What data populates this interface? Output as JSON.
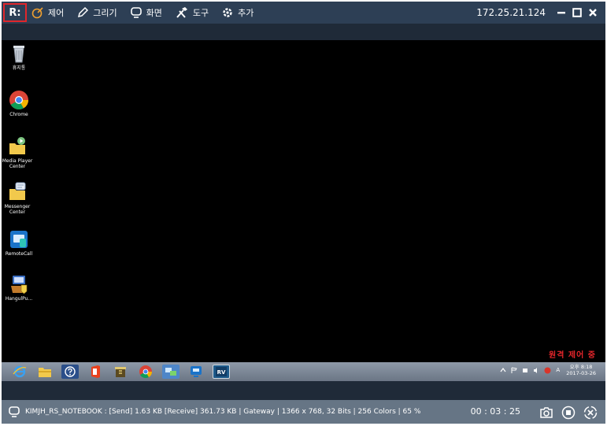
{
  "toolbar": {
    "logo": "R:",
    "menu": [
      {
        "label": "제어",
        "icon": "control-icon"
      },
      {
        "label": "그리기",
        "icon": "pen-icon"
      },
      {
        "label": "화면",
        "icon": "screen-icon"
      },
      {
        "label": "도구",
        "icon": "tools-icon"
      },
      {
        "label": "추가",
        "icon": "gear-icon"
      }
    ],
    "ip_address": "172.25.21.124"
  },
  "desktop": {
    "icons": [
      {
        "label": "휴지통",
        "icon": "recycle-bin-icon"
      },
      {
        "label": "Chrome",
        "icon": "chrome-icon"
      },
      {
        "label": "Media Player Center",
        "icon": "media-player-icon"
      },
      {
        "label": "Messenger Center",
        "icon": "messenger-icon"
      },
      {
        "label": "RemoteCall",
        "icon": "remotecall-icon"
      },
      {
        "label": "HangulPu...",
        "icon": "hangul-icon"
      }
    ],
    "remote_status": "원격 제어 중"
  },
  "taskbar": {
    "apps": [
      "ie-icon",
      "file-explorer-icon",
      "help-icon",
      "office-icon",
      "app-icon",
      "chrome-icon",
      "network-icon",
      "remote-icon",
      "rv-icon"
    ],
    "tray_lang": "A",
    "clock_time": "오후 8:18",
    "clock_date": "2017-03-26"
  },
  "statusbar": {
    "info": "KIMJH_RS_NOTEBOOK : [Send] 1.63 KB  [Receive] 361.73 KB | Gateway | 1366 x 768, 32 Bits | 256 Colors | 65 %",
    "timer": "00 : 03 : 25"
  },
  "colors": {
    "toolbar_bg": "#2d3f55",
    "status_bg": "#667585",
    "accent_red": "#e0262b"
  }
}
